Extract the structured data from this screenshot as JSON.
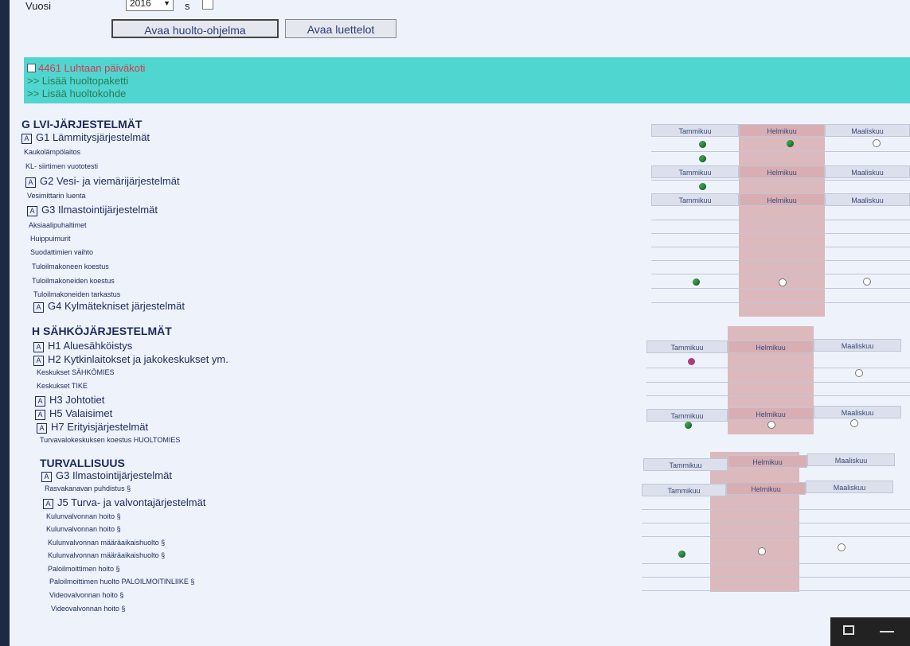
{
  "top": {
    "year_label": "Vuosi",
    "year_value": "2016",
    "year_unit": "s",
    "btn_program": "Avaa huolto-ohjelma",
    "btn_lists": "Avaa luettelot"
  },
  "banner": {
    "property": "4461 Luhtaan päiväkoti",
    "add_package": ">> Lisää huoltopaketti",
    "add_target": ">> Lisää huoltokohde"
  },
  "months": {
    "jan": "Tammikuu",
    "feb": "Helmikuu",
    "mar": "Maaliskuu"
  },
  "sections": {
    "g": {
      "title": "G LVI-JÄRJESTELMÄT",
      "g1": "G1 Lämmitysjärjestelmät",
      "g1_t1": "Kaukolämpölaitos",
      "g1_t2": "KL- siirtimen vuototesti",
      "g2": "G2 Vesi- ja viemärijärjestelmät",
      "g2_t1": "Vesimittarin luenta",
      "g3": "G3 Ilmastointijärjestelmät",
      "g3_t1": "Aksiaalipuhaltimet",
      "g3_t2": "Huippuimurit",
      "g3_t3": "Suodattimien vaihto",
      "g3_t4": "Tuloilmakoneen koestus",
      "g3_t5": "Tuloilmakoneiden koestus",
      "g3_t6": "Tuloilmakoneiden tarkastus",
      "g4": "G4 Kylmätekniset järjestelmät"
    },
    "h": {
      "title": "H SÄHKÖJÄRJESTELMÄT",
      "h1": "H1 Aluesähköistys",
      "h2": "H2 Kytkinlaitokset ja jakokeskukset ym.",
      "h2_t1": "Keskukset SÄHKÖMIES",
      "h2_t2": "Keskukset TIKE",
      "h3": "H3 Johtotiet",
      "h5": "H5 Valaisimet",
      "h7": "H7 Erityisjärjestelmät",
      "h7_t1": "Turvavalokeskuksen koestus HUOLTOMIES"
    },
    "t": {
      "title": "TURVALLISUUS",
      "g3": "G3 Ilmastointijärjestelmät",
      "g3_t1": "Rasvakanavan puhdistus §",
      "j5": "J5 Turva- ja valvontajärjestelmät",
      "j5_t1": "Kulunvalvonnan hoito §",
      "j5_t2": "Kulunvalvonnan hoito §",
      "j5_t3": "Kulunvalvonnan määräaikaishuolto §",
      "j5_t4": "Kulunvalvonnan määräaikaishuolto §",
      "j5_t5": "Paloilmoittimen hoito §",
      "j5_t6": "Paloilmoittimen huolto PALOILMOITINLIIKE §",
      "j5_t7": "Videovalvonnan hoito §",
      "j5_t8": "Videovalvonnan hoito §"
    }
  },
  "status_legend": {
    "done": "green",
    "planned": "white",
    "overdue": "purple"
  },
  "colors": {
    "banner": "#4fd6d0",
    "property": "#d83a4e",
    "feb_column": "#dcb9bc"
  }
}
